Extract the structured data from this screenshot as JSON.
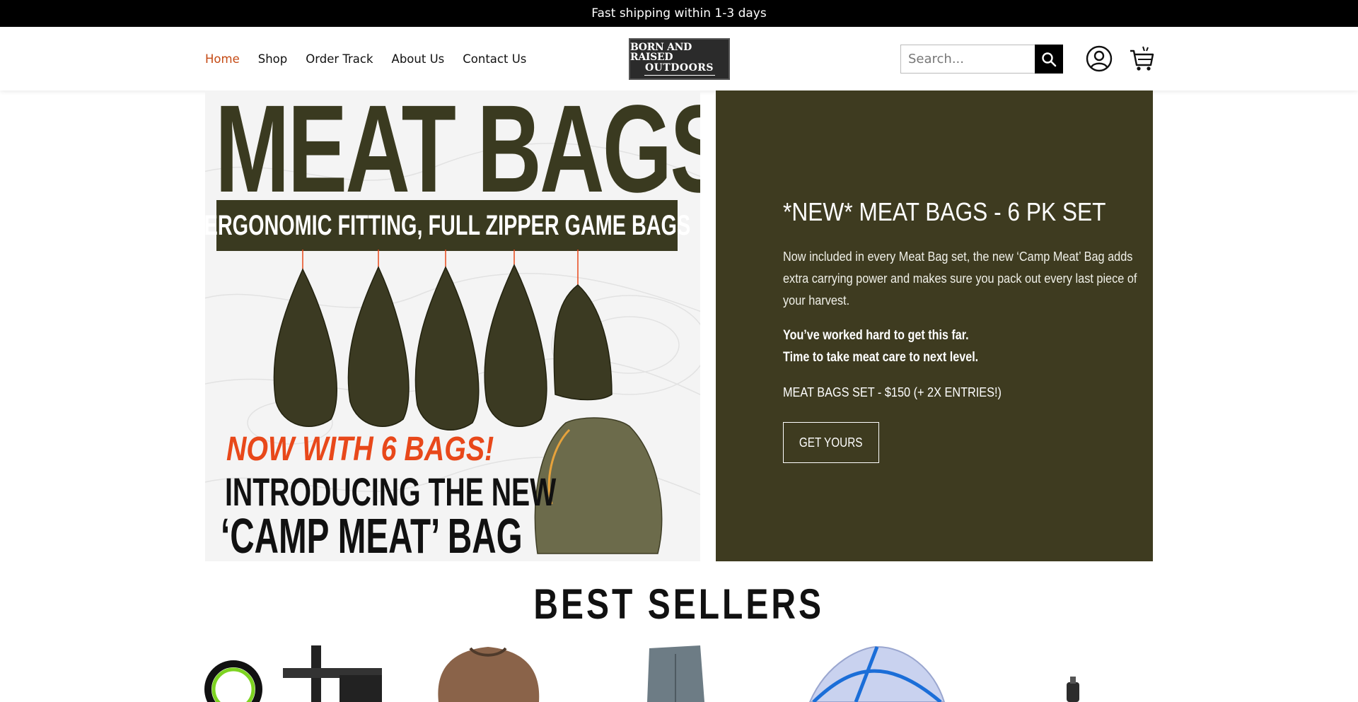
{
  "announcement": "Fast shipping within 1-3 days",
  "nav": {
    "items": [
      {
        "label": "Home",
        "active": true
      },
      {
        "label": "Shop",
        "active": false
      },
      {
        "label": "Order Track",
        "active": false
      },
      {
        "label": "About Us",
        "active": false
      },
      {
        "label": "Contact Us",
        "active": false
      }
    ]
  },
  "logo": {
    "line1": "BORN AND RAISED",
    "line2": "OUTDOORS"
  },
  "search": {
    "placeholder": "Search..."
  },
  "hero_image": {
    "title": "MEAT BAGS",
    "banner": "ERGONOMIC FITTING, FULL ZIPPER GAME BAGS",
    "callout": "NOW WITH 6 BAGS!",
    "intro_line1": "INTRODUCING THE NEW",
    "intro_line2": "‘CAMP MEAT’ BAG"
  },
  "promo": {
    "title": "*NEW* MEAT BAGS - 6 PK SET",
    "description": "Now included in every Meat Bag set, the new ‘Camp Meat’ Bag adds extra carrying power and makes sure you pack out every last piece of your harvest.",
    "bold_line1": "You’ve worked hard to get this far.",
    "bold_line2": "Time to take meat care to next level.",
    "price": "MEAT BAGS SET - $150 (+ 2X ENTRIES!)",
    "button": "GET YOURS"
  },
  "section_title": "BEST SELLERS",
  "colors": {
    "accent": "#c54a14",
    "promo_bg": "#3e3b20",
    "bag_olive": "#3b3a22",
    "callout_orange": "#e8481a"
  }
}
